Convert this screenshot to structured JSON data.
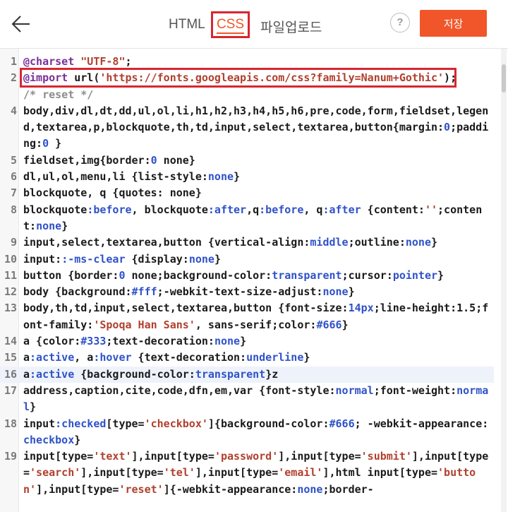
{
  "header": {
    "back_icon": "arrow-left-icon",
    "tabs": [
      "HTML",
      "CSS",
      "파일업로드"
    ],
    "active_tab": "CSS",
    "help_label": "?",
    "save_label": "저장",
    "accent_color": "#f0562a",
    "highlight_color": "#d9262f"
  },
  "editor": {
    "language": "css",
    "active_line": 16,
    "lines": [
      {
        "num": "1",
        "text": "@charset \"UTF-8\";"
      },
      {
        "num": "2",
        "text": "@import url('https://fonts.googleapis.com/css?family=Nanum+Gothic');"
      },
      {
        "num": "",
        "text": "/* reset */"
      },
      {
        "num": "4",
        "text": "body,div,dl,dt,dd,ul,ol,li,h1,h2,h3,h4,h5,h6,pre,code,form,fieldset,legend,textarea,p,blockquote,th,td,input,select,textarea,button{margin:0;padding:0 }"
      },
      {
        "num": "5",
        "text": "fieldset,img{border:0 none}"
      },
      {
        "num": "6",
        "text": "dl,ul,ol,menu,li {list-style:none}"
      },
      {
        "num": "7",
        "text": "blockquote, q {quotes: none}"
      },
      {
        "num": "8",
        "text": "blockquote:before, blockquote:after,q:before, q:after {content:'';content:none}"
      },
      {
        "num": "9",
        "text": "input,select,textarea,button {vertical-align:middle;outline:none}"
      },
      {
        "num": "10",
        "text": "input::-ms-clear {display:none}"
      },
      {
        "num": "11",
        "text": "button {border:0 none;background-color:transparent;cursor:pointer}"
      },
      {
        "num": "12",
        "text": "body {background:#fff;-webkit-text-size-adjust:none}"
      },
      {
        "num": "13",
        "text": "body,th,td,input,select,textarea,button {font-size:14px;line-height:1.5;font-family:'Spoqa Han Sans', sans-serif;color:#666}"
      },
      {
        "num": "14",
        "text": "a {color:#333;text-decoration:none}"
      },
      {
        "num": "15",
        "text": "a:active, a:hover {text-decoration:underline}"
      },
      {
        "num": "16",
        "text": "a:active {background-color:transparent}z"
      },
      {
        "num": "17",
        "text": "address,caption,cite,code,dfn,em,var {font-style:normal;font-weight:normal}"
      },
      {
        "num": "18",
        "text": "input:checked[type='checkbox']{background-color:#666; -webkit-appearance:checkbox}"
      },
      {
        "num": "19",
        "text": "input[type='text'],input[type='password'],input[type='submit'],input[type='search'],input[type='tel'],input[type='email'],html input[type='button'],input[type='reset']{-webkit-appearance:none;border-"
      }
    ]
  }
}
